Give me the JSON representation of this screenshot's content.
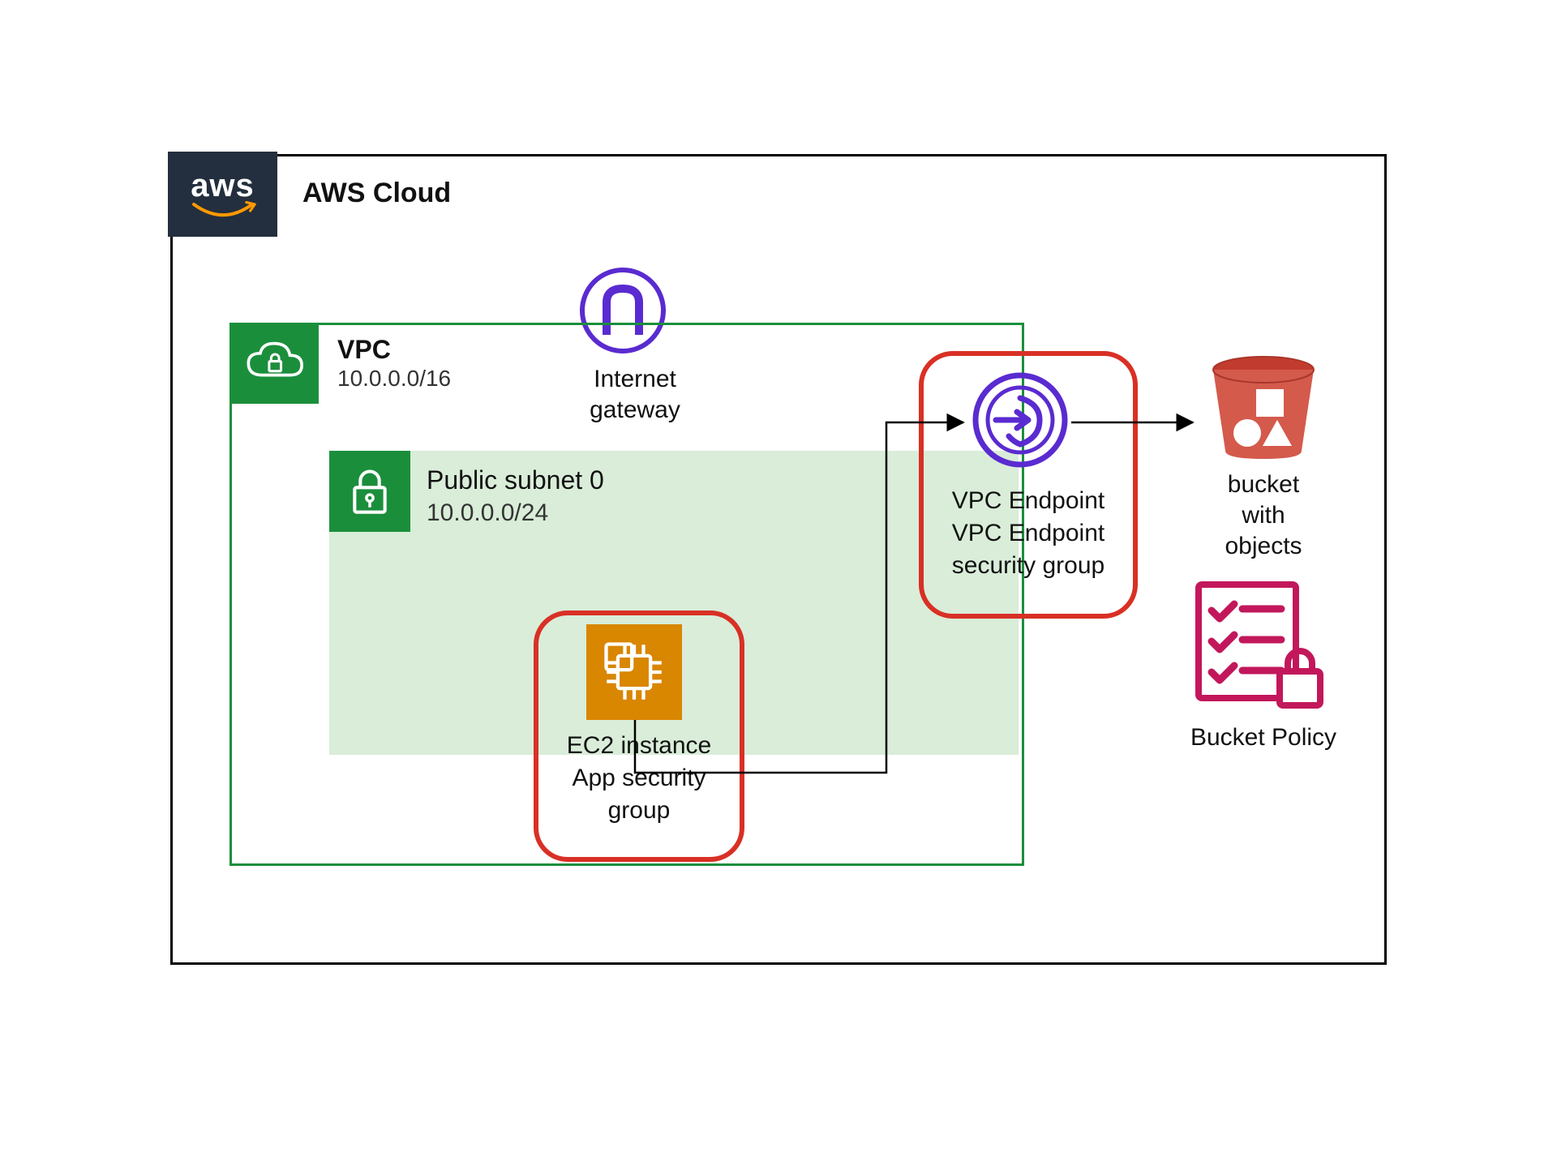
{
  "cloud": {
    "title": "AWS Cloud",
    "logo": "aws"
  },
  "vpc": {
    "title": "VPC",
    "cidr": "10.0.0.0/16",
    "icon": "vpc-cloud-lock-icon"
  },
  "subnet": {
    "title": "Public subnet 0",
    "cidr": "10.0.0.0/24",
    "icon": "subnet-lock-icon"
  },
  "igw": {
    "line1": "Internet",
    "line2": "gateway",
    "icon": "internet-gateway-icon"
  },
  "ec2": {
    "line1": "EC2 instance",
    "line2": "App security",
    "line3": "group",
    "icon": "ec2-chip-icon"
  },
  "vpce": {
    "line1": "VPC Endpoint",
    "line2": "VPC Endpoint",
    "line3": "security group",
    "icon": "vpc-endpoint-icon"
  },
  "bucket": {
    "line1": "bucket",
    "line2": "with",
    "line3": "objects",
    "icon": "s3-bucket-icon"
  },
  "policy": {
    "label": "Bucket Policy",
    "icon": "bucket-policy-icon"
  },
  "colors": {
    "aws_navy": "#232f3e",
    "vpc_green": "#1b8e3c",
    "subnet_fill": "#d9edd9",
    "ec2_orange": "#d98600",
    "highlight_red": "#d93025",
    "endpoint_purple": "#5a2bd0",
    "s3_red": "#c13c2e",
    "policy_magenta": "#c2185b"
  }
}
